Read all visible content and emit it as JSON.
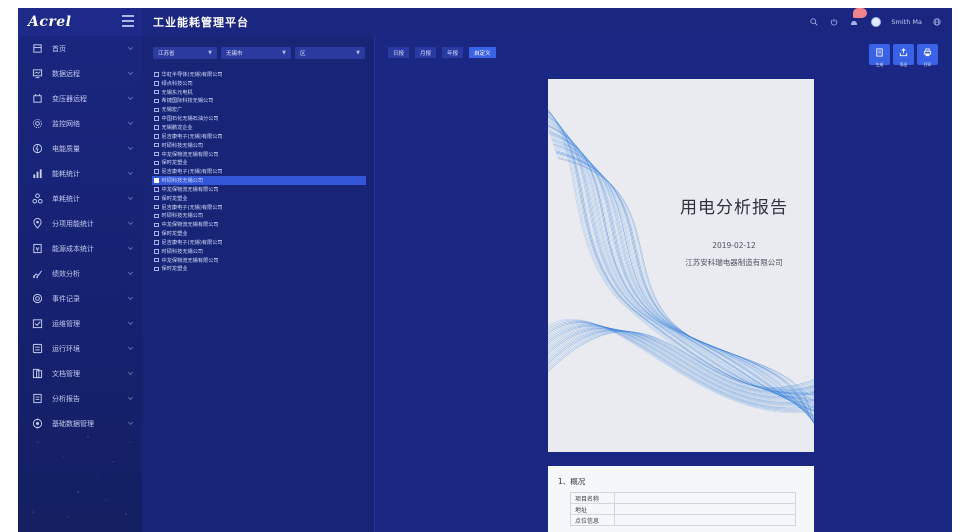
{
  "app": {
    "logo": "Acrel",
    "title": "工业能耗管理平台",
    "user_name": "Smith Ma"
  },
  "colors": {
    "header_bg": "#1a2680",
    "sidebar_bg": "#1a267e",
    "accent": "#3a62e6",
    "selected_row": "#3457d9",
    "notification_badge": "#f2828c"
  },
  "sidebar": {
    "items": [
      {
        "label": "首页",
        "icon": "home-icon"
      },
      {
        "label": "数据远程",
        "icon": "monitor-icon"
      },
      {
        "label": "变压器远程",
        "icon": "transformer-icon"
      },
      {
        "label": "监控网络",
        "icon": "network-icon"
      },
      {
        "label": "电能质量",
        "icon": "power-quality-icon"
      },
      {
        "label": "能耗统计",
        "icon": "bar-chart-icon"
      },
      {
        "label": "单耗统计",
        "icon": "nodes-icon"
      },
      {
        "label": "分项用能统计",
        "icon": "location-icon"
      },
      {
        "label": "能源成本统计",
        "icon": "cost-icon"
      },
      {
        "label": "绩效分析",
        "icon": "trend-icon"
      },
      {
        "label": "事件记录",
        "icon": "event-icon"
      },
      {
        "label": "运维管理",
        "icon": "maintenance-icon"
      },
      {
        "label": "运行环境",
        "icon": "environment-icon"
      },
      {
        "label": "文档管理",
        "icon": "document-icon"
      },
      {
        "label": "分析报告",
        "icon": "report-icon"
      },
      {
        "label": "基础数据管理",
        "icon": "database-icon"
      }
    ]
  },
  "filters": {
    "province": "江苏省",
    "city": "无锡市",
    "district": "区"
  },
  "tree": {
    "items": [
      "华虹半导体(无锡)有限公司",
      "绿点科技公司",
      "无锡东元电机",
      "希捷国际科技无锡公司",
      "无锡宏广",
      "中国石化无锡石油分公司",
      "无锡鹏龙企业",
      "尼吉康电子(无锡)有限公司",
      "时硕科技无锡公司",
      "中龙保物流无锡有限公司",
      "保时龙塑业",
      "尼吉康电子(无锡)有限公司",
      "时硕科技无锡公司",
      "中龙保物流无锡有限公司",
      "保时龙塑业",
      "尼吉康电子(无锡)有限公司",
      "时硕科技无锡公司",
      "中龙保物流无锡有限公司",
      "保时龙塑业",
      "尼吉康电子(无锡)有限公司",
      "时硕科技无锡公司",
      "中龙保物流无锡有限公司",
      "保时龙塑业"
    ],
    "selected_index": 12
  },
  "tabs": [
    {
      "label": "日报"
    },
    {
      "label": "月报"
    },
    {
      "label": "年报"
    },
    {
      "label": "自定义"
    }
  ],
  "active_tab": 3,
  "actions": [
    {
      "label": "生成",
      "icon": "generate-icon"
    },
    {
      "label": "导出",
      "icon": "export-icon"
    },
    {
      "label": "打印",
      "icon": "print-icon"
    }
  ],
  "report": {
    "title": "用电分析报告",
    "date": "2019-02-12",
    "company": "江苏安科瑞电器制造有限公司",
    "section_heading": "1、概况",
    "table_rows": [
      {
        "key": "项目名称",
        "value": ""
      },
      {
        "key": "地址",
        "value": ""
      },
      {
        "key": "点位信息",
        "value": ""
      }
    ]
  }
}
